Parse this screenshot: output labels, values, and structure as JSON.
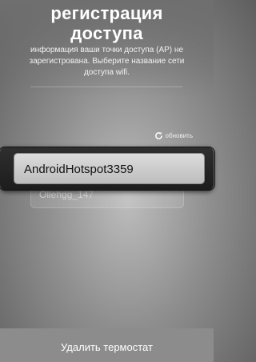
{
  "header": {
    "title_line1": "регистрация",
    "title_line2": "доступа",
    "description": "информация ваши точки доступа (AP) не зарегистрована. Выберите название сети доступа wifi."
  },
  "refresh": {
    "label": "обновить",
    "icon": "refresh-icon"
  },
  "network_list": {
    "items": [
      "AndroidHotspot3359",
      "Ollehgg_147"
    ],
    "selected": "AndroidHotspot3359"
  },
  "footer": {
    "delete_label": "Удалить термостат"
  }
}
